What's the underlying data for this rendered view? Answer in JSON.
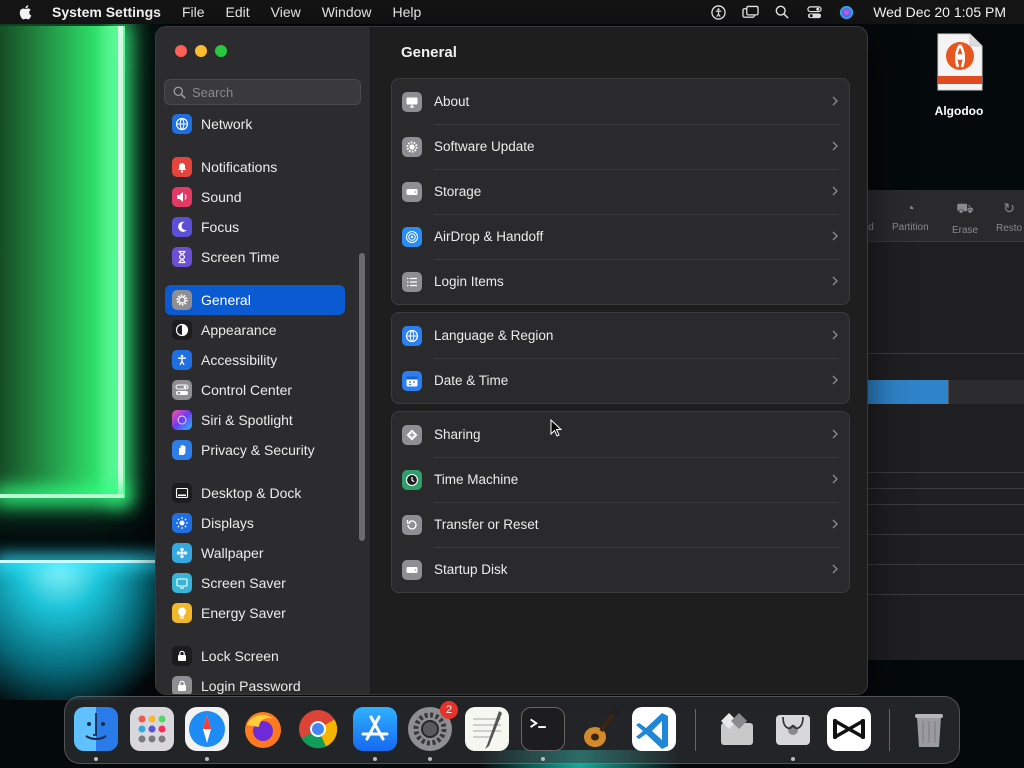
{
  "menubar": {
    "app_name": "System Settings",
    "items": [
      "File",
      "Edit",
      "View",
      "Window",
      "Help"
    ],
    "clock": "Wed Dec 20  1:05 PM"
  },
  "desktop": {
    "icons": [
      {
        "label": "Algodoo",
        "icon": "algodoo-doc-icon"
      }
    ]
  },
  "background_window": {
    "toolbar": [
      "id",
      "Partition",
      "Erase",
      "Resto"
    ]
  },
  "settings": {
    "search": {
      "placeholder": "Search"
    },
    "sidebar": {
      "selected": "General",
      "items": [
        {
          "label": "Network",
          "icon": "globe-icon",
          "color": "#1f6fe0"
        },
        {
          "label": "Notifications",
          "icon": "bell-icon",
          "color": "#e5443d"
        },
        {
          "label": "Sound",
          "icon": "speaker-icon",
          "color": "#e23a64"
        },
        {
          "label": "Focus",
          "icon": "moon-icon",
          "color": "#5b4fd8"
        },
        {
          "label": "Screen Time",
          "icon": "hourglass-icon",
          "color": "#6c4fd4"
        },
        {
          "label": "General",
          "icon": "gear-icon",
          "color": "#8e8e93"
        },
        {
          "label": "Appearance",
          "icon": "appearance-icon",
          "color": "#1c1c1e"
        },
        {
          "label": "Accessibility",
          "icon": "accessibility-icon",
          "color": "#1f6fe0"
        },
        {
          "label": "Control Center",
          "icon": "toggles-icon",
          "color": "#8e8e93"
        },
        {
          "label": "Siri & Spotlight",
          "icon": "siri-icon",
          "color": "#8e3cd6"
        },
        {
          "label": "Privacy & Security",
          "icon": "hand-icon",
          "color": "#2f7de6"
        },
        {
          "label": "Desktop & Dock",
          "icon": "dock-icon",
          "color": "#1c1c1e"
        },
        {
          "label": "Displays",
          "icon": "sun-icon",
          "color": "#1f6fe0"
        },
        {
          "label": "Wallpaper",
          "icon": "flower-icon",
          "color": "#36a8e0"
        },
        {
          "label": "Screen Saver",
          "icon": "screensaver-icon",
          "color": "#38b5d6"
        },
        {
          "label": "Energy Saver",
          "icon": "bulb-icon",
          "color": "#f0b82a"
        },
        {
          "label": "Lock Screen",
          "icon": "lock-icon",
          "color": "#1c1c1e"
        },
        {
          "label": "Login Password",
          "icon": "padlock-icon",
          "color": "#8e8e93"
        }
      ]
    },
    "main": {
      "title": "General",
      "groups": [
        [
          {
            "label": "About",
            "icon": "computer-icon",
            "color": "#8e8e93"
          },
          {
            "label": "Software Update",
            "icon": "gear-badge-icon",
            "color": "#8e8e93"
          },
          {
            "label": "Storage",
            "icon": "drive-icon",
            "color": "#8e8e93"
          },
          {
            "label": "AirDrop & Handoff",
            "icon": "airdrop-icon",
            "color": "#2b8df0"
          },
          {
            "label": "Login Items",
            "icon": "list-icon",
            "color": "#8e8e93"
          }
        ],
        [
          {
            "label": "Language & Region",
            "icon": "globe-icon",
            "color": "#2b7ff0"
          },
          {
            "label": "Date & Time",
            "icon": "calendar-icon",
            "color": "#2b7ff0"
          }
        ],
        [
          {
            "label": "Sharing",
            "icon": "sharing-icon",
            "color": "#8e8e93"
          },
          {
            "label": "Time Machine",
            "icon": "clock-icon",
            "color": "#2f9e6a"
          },
          {
            "label": "Transfer or Reset",
            "icon": "reset-icon",
            "color": "#8e8e93"
          },
          {
            "label": "Startup Disk",
            "icon": "disk-icon",
            "color": "#8e8e93"
          }
        ]
      ]
    }
  },
  "dock": {
    "apps": [
      {
        "name": "Finder",
        "icon": "finder-icon",
        "running": true
      },
      {
        "name": "Launchpad",
        "icon": "launchpad-icon",
        "running": false
      },
      {
        "name": "Safari",
        "icon": "safari-icon",
        "running": true
      },
      {
        "name": "Firefox",
        "icon": "firefox-icon",
        "running": false
      },
      {
        "name": "Chrome",
        "icon": "chrome-icon",
        "running": false
      },
      {
        "name": "App Store",
        "icon": "appstore-icon",
        "running": true
      },
      {
        "name": "System Settings",
        "icon": "system-settings-icon",
        "running": true,
        "badge": "2"
      },
      {
        "name": "TextEdit",
        "icon": "textedit-icon",
        "running": false
      },
      {
        "name": "Terminal",
        "icon": "terminal-icon",
        "running": true
      },
      {
        "name": "GarageBand",
        "icon": "garageband-icon",
        "running": false
      },
      {
        "name": "Visual Studio Code",
        "icon": "vscode-icon",
        "running": false
      },
      {
        "name": "Boot Camp Assistant",
        "icon": "bootcamp-icon",
        "running": false
      },
      {
        "name": "Disk Utility",
        "icon": "disk-utility-icon",
        "running": true
      },
      {
        "name": "CapCut",
        "icon": "capcut-icon",
        "running": false
      },
      {
        "name": "Trash",
        "icon": "trash-icon",
        "running": false
      }
    ]
  }
}
